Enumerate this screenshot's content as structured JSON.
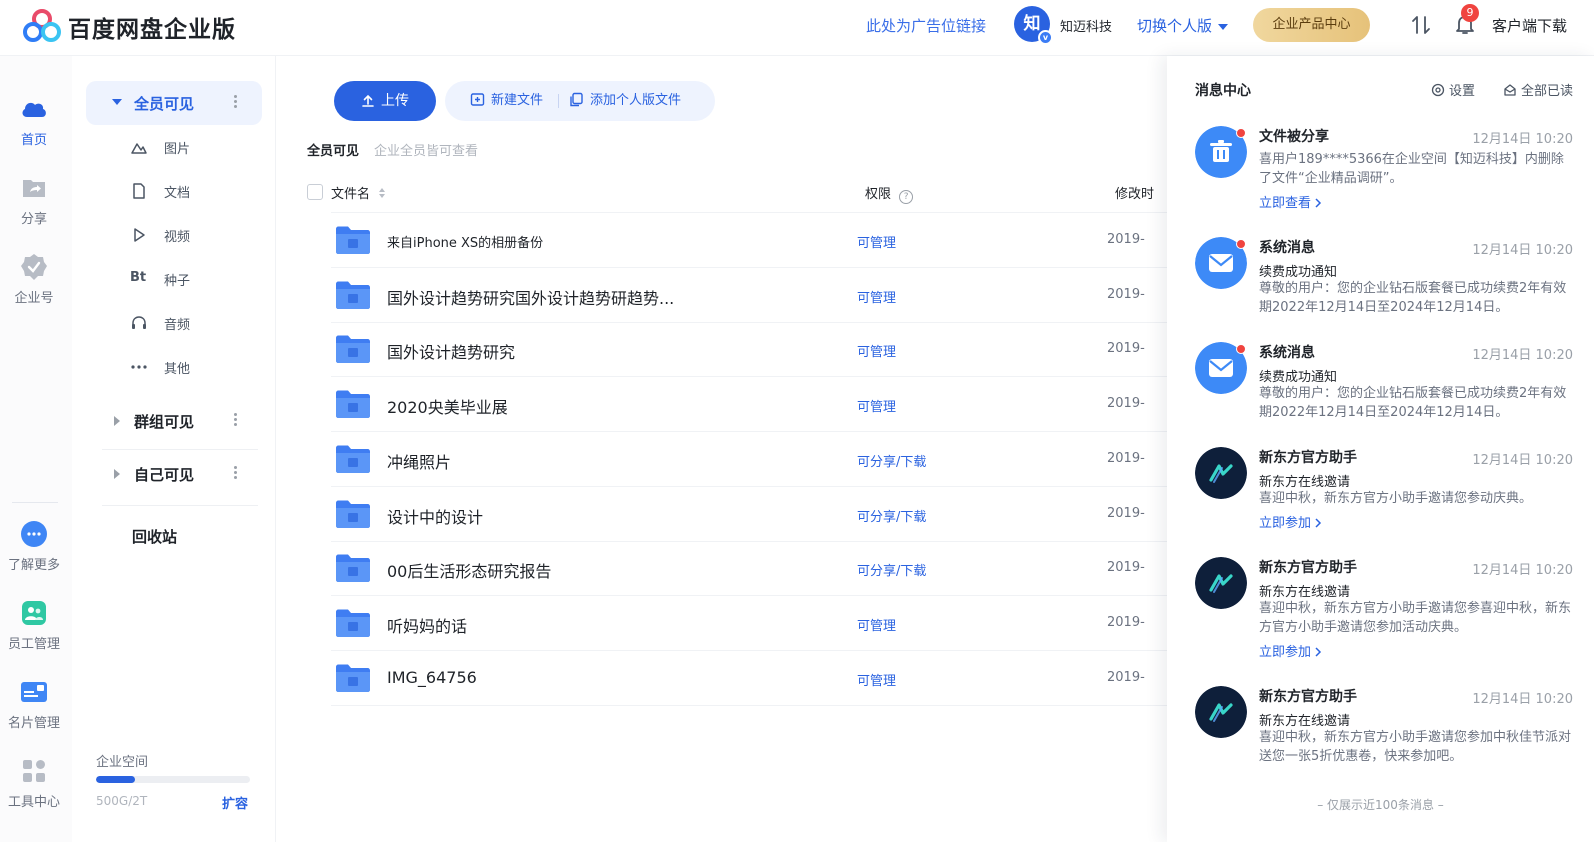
{
  "header": {
    "brand": "百度网盘企业版",
    "ad_link": "此处为广告位链接",
    "org_avatar_char": "知",
    "org_badge": "v",
    "org_name": "知迈科技",
    "switch_label": "切换个人版",
    "product_center": "企业产品中心",
    "notification_count": "9",
    "client_download": "客户端下载"
  },
  "rail": {
    "items": [
      {
        "label": "首页",
        "icon": "cloud-icon"
      },
      {
        "label": "分享",
        "icon": "share-folder-icon"
      },
      {
        "label": "企业号",
        "icon": "verified-badge-icon"
      },
      {
        "label": "了解更多",
        "icon": "chat-bubble-icon"
      },
      {
        "label": "员工管理",
        "icon": "people-icon"
      },
      {
        "label": "名片管理",
        "icon": "id-card-icon"
      },
      {
        "label": "工具中心",
        "icon": "apps-grid-icon"
      }
    ]
  },
  "categories": {
    "all_visible": "全员可见",
    "sub_items": [
      {
        "label": "图片",
        "icon": "image-icon"
      },
      {
        "label": "文档",
        "icon": "document-icon"
      },
      {
        "label": "视频",
        "icon": "video-icon"
      },
      {
        "label": "种子",
        "icon": "torrent-icon",
        "glyph": "Bt"
      },
      {
        "label": "音频",
        "icon": "headphones-icon"
      },
      {
        "label": "其他",
        "icon": "more-icon"
      }
    ],
    "group_visible": "群组可见",
    "self_visible": "自己可见",
    "recycle_bin": "回收站",
    "storage": {
      "label": "企业空间",
      "used_text": "500G/2T",
      "used_fraction": 0.25,
      "expand": "扩容"
    }
  },
  "toolbar": {
    "upload": "上传",
    "new_file": "新建文件",
    "add_personal": "添加个人版文件"
  },
  "scope": {
    "title": "全员可见",
    "subtitle": "企业全员皆可查看"
  },
  "table": {
    "col_name": "文件名",
    "col_perm": "权限",
    "col_modified": "修改时",
    "rows": [
      {
        "name": "来自iPhone XS的相册备份",
        "perm": "可管理",
        "date": "2019-",
        "small": true
      },
      {
        "name": "国外设计趋势研究国外设计趋势研趋势...",
        "perm": "可管理",
        "date": "2019-"
      },
      {
        "name": "国外设计趋势研究",
        "perm": "可管理",
        "date": "2019-"
      },
      {
        "name": "2020央美毕业展",
        "perm": "可管理",
        "date": "2019-"
      },
      {
        "name": "冲绳照片",
        "perm": "可分享/下载",
        "date": "2019-"
      },
      {
        "name": "设计中的设计",
        "perm": "可分享/下载",
        "date": "2019-"
      },
      {
        "name": "00后生活形态研究报告",
        "perm": "可分享/下载",
        "date": "2019-"
      },
      {
        "name": "听妈妈的话",
        "perm": "可管理",
        "date": "2019-"
      },
      {
        "name": "IMG_64756",
        "perm": "可管理",
        "date": "2019-"
      }
    ]
  },
  "messages": {
    "title": "消息中心",
    "settings": "设置",
    "read_all": "全部已读",
    "footer": "– 仅展示近100条消息 –",
    "items": [
      {
        "title": "文件被分享",
        "time": "12月14日 10:20",
        "sub": "",
        "body": "喜用户189****5366在企业空间【知迈科技】内删除了文件“企业精品调研”。",
        "link": "立即查看",
        "avatar": "trash-icon",
        "unread": true
      },
      {
        "title": "系统消息",
        "time": "12月14日 10:20",
        "sub": "续费成功通知",
        "body": "尊敬的用户：您的企业钻石版套餐已成功续费2年有效期2022年12月14日至2024年12月14日。",
        "link": "",
        "avatar": "mail-icon",
        "unread": true
      },
      {
        "title": "系统消息",
        "time": "12月14日 10:20",
        "sub": "续费成功通知",
        "body": "尊敬的用户：您的企业钻石版套餐已成功续费2年有效期2022年12月14日至2024年12月14日。",
        "link": "",
        "avatar": "mail-icon",
        "unread": true
      },
      {
        "title": "新东方官方助手",
        "time": "12月14日 10:20",
        "sub": "新东方在线邀请",
        "body": "喜迎中秋，新东方官方小助手邀请您参动庆典。",
        "link": "立即参加",
        "avatar": "xdf-logo-icon",
        "unread": false
      },
      {
        "title": "新东方官方助手",
        "time": "12月14日 10:20",
        "sub": "新东方在线邀请",
        "body": "喜迎中秋，新东方官方小助手邀请您参喜迎中秋，新东方官方小助手邀请您参加活动庆典。",
        "link": "立即参加",
        "avatar": "xdf-logo-icon",
        "unread": false
      },
      {
        "title": "新东方官方助手",
        "time": "12月14日 10:20",
        "sub": "新东方在线邀请",
        "body": "喜迎中秋，新东方官方小助手邀请您参加中秋佳节派对送您一张5折优惠卷，快来参加吧。",
        "link": "",
        "avatar": "xdf-logo-icon",
        "unread": false
      }
    ]
  },
  "colors": {
    "accent": "#2a62e0",
    "gold_button": "#e6c27a",
    "badge_red": "#f0443f"
  }
}
